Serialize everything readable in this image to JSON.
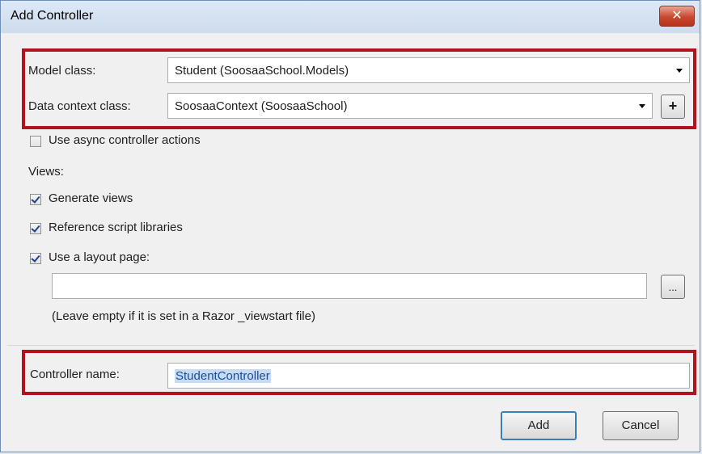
{
  "window": {
    "title": "Add Controller",
    "close_glyph": "✕"
  },
  "model_class": {
    "label": "Model class:",
    "value": "Student (SoosaaSchool.Models)"
  },
  "data_context_class": {
    "label": "Data context class:",
    "value": "SoosaaContext (SoosaaSchool)",
    "add_glyph": "+"
  },
  "options": {
    "use_async": {
      "label": "Use async controller actions",
      "checked": false
    },
    "views_heading": "Views:",
    "generate_views": {
      "label": "Generate views",
      "checked": true
    },
    "reference_scripts": {
      "label": "Reference script libraries",
      "checked": true
    },
    "use_layout": {
      "label": "Use a layout page:",
      "checked": true
    }
  },
  "layout_page": {
    "value": "",
    "browse_label": "...",
    "hint": "(Leave empty if it is set in a Razor _viewstart file)"
  },
  "controller_name": {
    "label": "Controller name:",
    "value": "StudentController"
  },
  "buttons": {
    "add": "Add",
    "cancel": "Cancel"
  },
  "colors": {
    "highlight": "#b1121c",
    "selection": "#c7dcf3",
    "titlebar": "#dde8f6"
  },
  "icons": {
    "close": "close-icon",
    "dropdown": "chevron-down-icon",
    "add": "plus-icon"
  }
}
